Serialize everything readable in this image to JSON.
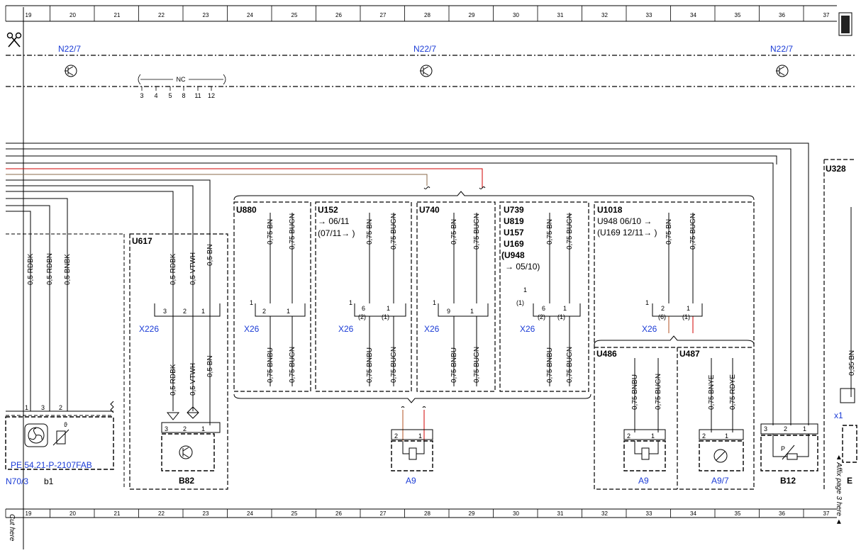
{
  "ruler": {
    "columns": [
      "19",
      "20",
      "21",
      "22",
      "23",
      "24",
      "25",
      "26",
      "27",
      "28",
      "29",
      "30",
      "31",
      "32",
      "33",
      "34",
      "35",
      "36",
      "37"
    ]
  },
  "top": {
    "n22_label": "N22/7",
    "nc_label": "NC",
    "nc_pins": [
      "3",
      "4",
      "5",
      "8",
      "11",
      "12"
    ]
  },
  "groups": {
    "u880": "U880",
    "u152": "U152",
    "u152_d1": "→ 06/11",
    "u152_d2": "(07/11→ )",
    "u740": "U740",
    "u739": [
      "U739",
      "U819",
      "U157",
      "U169"
    ],
    "u948_paren": "(U948",
    "u948_date": "→ 05/10)",
    "u1018": "U1018",
    "u948_line": "U948  06/10 →",
    "u169_line": "(U169 12/11→ )",
    "u617": "U617",
    "u486": "U486",
    "u487": "U487",
    "u328": "U328"
  },
  "wires": {
    "rdbk05": "0,5 RDBK",
    "rdbn05": "0,5 RDBN",
    "bnbk05": "0,5 BNBK",
    "vtwh05": "0,5 VTWH",
    "bn05": "0,5 BN",
    "bn075": "0,75 BN",
    "bugn075": "0,75 BUGN",
    "bnbu075": "0,75 BNBU",
    "bnye075": "0,75 BNYE",
    "rdye075": "0,75 RDYE",
    "bn035": "0,35 BN"
  },
  "connectors": {
    "x226": "X226",
    "x26": "X26",
    "x1": "x1",
    "pin1": "1",
    "pin2": "2",
    "pin3": "3",
    "pin6": "6",
    "pin9": "9",
    "p2": "(2)",
    "p1": "(1)",
    "p6": "(6)"
  },
  "components": {
    "b82": "B82",
    "a9": "A9",
    "a97": "A9/7",
    "b12": "B12",
    "pe_ref": "PE 54.21-P-2107FAB",
    "n703": "N70/3",
    "b1": "b1",
    "theta": "ϑ",
    "p": "P",
    "e": "E"
  },
  "side": {
    "cut_here": "Cut here",
    "affix": "◄ Affix page 3 here ◄"
  }
}
